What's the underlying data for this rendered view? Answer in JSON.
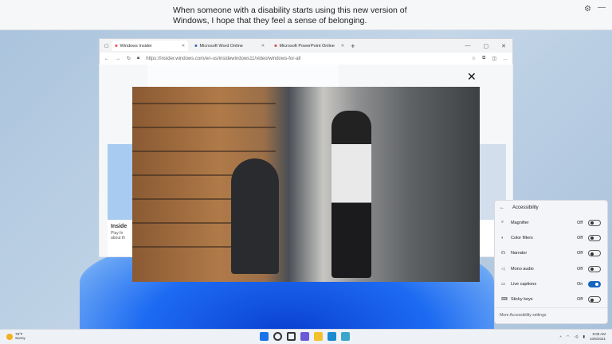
{
  "caption": {
    "text": "When someone with a disability starts using this new version of Windows, I hope that they feel a sense of belonging.",
    "icons": [
      "gear-icon",
      "minimize-icon"
    ]
  },
  "browser": {
    "tabs": [
      {
        "label": "Windows Insider",
        "active": true
      },
      {
        "label": "Microsoft Word Online",
        "active": false
      },
      {
        "label": "Microsoft PowerPoint Online",
        "active": false
      }
    ],
    "new_tab": "+",
    "url": "https://insider.windows.com/en-us/insidewindows11/video/windows-for-all",
    "page_text": [
      "Inside",
      "Play fo",
      "about th"
    ]
  },
  "video_close": "✕",
  "accessibility": {
    "title": "Accessibility",
    "items": [
      {
        "label": "Magnifier",
        "state": "Off",
        "on": false,
        "icon": "magnifier-icon"
      },
      {
        "label": "Color filters",
        "state": "Off",
        "on": false,
        "icon": "color-filters-icon"
      },
      {
        "label": "Narrator",
        "state": "Off",
        "on": false,
        "icon": "narrator-icon"
      },
      {
        "label": "Mono audio",
        "state": "Off",
        "on": false,
        "icon": "mono-audio-icon"
      },
      {
        "label": "Live captions",
        "state": "On",
        "on": true,
        "icon": "live-captions-icon"
      },
      {
        "label": "Sticky keys",
        "state": "Off",
        "on": false,
        "icon": "sticky-keys-icon"
      }
    ],
    "footer": "More Accessibility settings"
  },
  "taskbar": {
    "weather_temp": "78°F",
    "weather_desc": "Sunny",
    "time": "9:08 AM",
    "date": "10/6/2021",
    "apps": [
      "start",
      "search",
      "task-view",
      "chat",
      "file-explorer",
      "edge",
      "store"
    ],
    "colors": {
      "start": "#1a73e8",
      "search": "#333333",
      "task-view": "#333333",
      "chat": "#6b5bd6",
      "file-explorer": "#f2c12e",
      "edge": "#1b8ad1",
      "store": "#3ba6c9"
    }
  }
}
